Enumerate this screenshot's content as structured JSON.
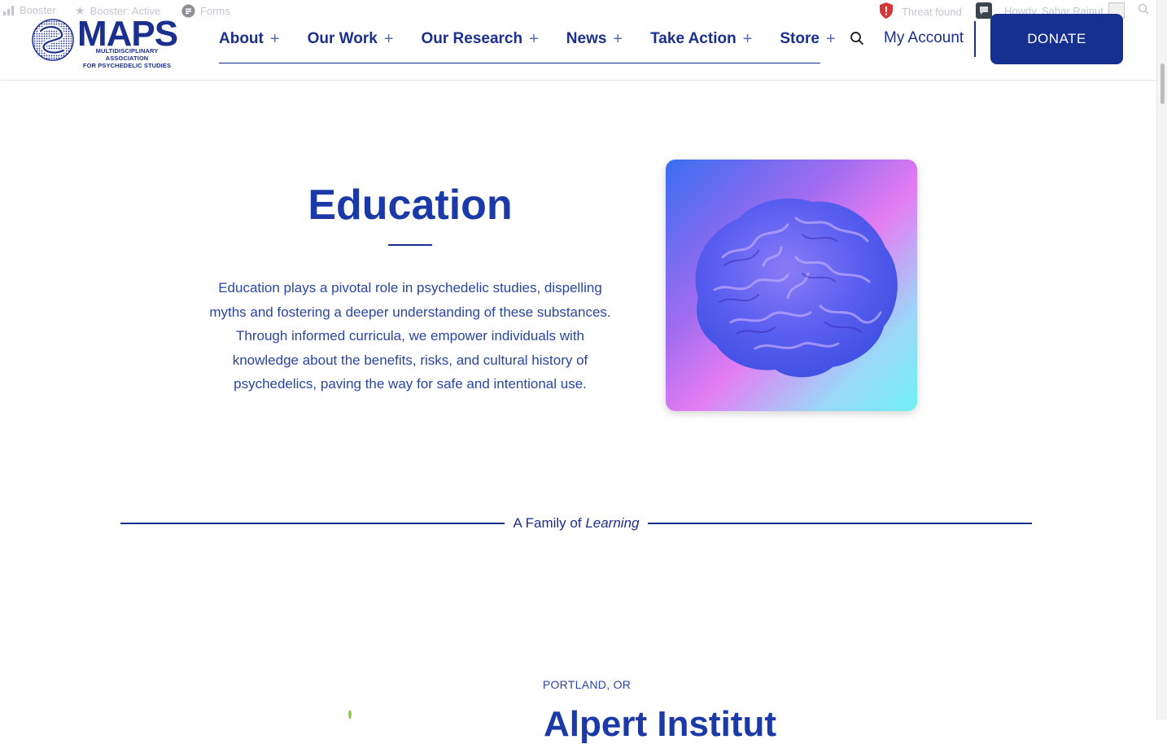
{
  "admin_bar": {
    "booster": "Booster",
    "booster_status": "Booster: Active",
    "forms": "Forms",
    "threat": "Threat found",
    "howdy": "Howdy, Sahar Rajput"
  },
  "header": {
    "logo_text": "MAPS",
    "logo_subtitle_line1": "MULTIDISCIPLINARY ASSOCIATION",
    "logo_subtitle_line2": "FOR PSYCHEDELIC STUDIES",
    "nav": [
      {
        "label": "About",
        "expand": "+"
      },
      {
        "label": "Our Work",
        "expand": "+"
      },
      {
        "label": "Our Research",
        "expand": "+"
      },
      {
        "label": "News",
        "expand": "+"
      },
      {
        "label": "Take Action",
        "expand": "+"
      },
      {
        "label": "Store",
        "expand": "+"
      }
    ],
    "my_account": "My Account",
    "donate": "DONATE"
  },
  "hero": {
    "title": "Education",
    "body": "Education plays a pivotal role in psychedelic studies, dispelling myths and fostering a deeper understanding of these substances. Through informed curricula, we empower individuals with knowledge about the benefits, risks, and cultural history of psychedelics, paving the way for safe and intentional use."
  },
  "section": {
    "family_prefix": "A Family of ",
    "family_emphasis": "Learning",
    "location": "PORTLAND, OR",
    "next_title": "Alpert Institut"
  },
  "colors": {
    "brand_blue": "#1b2f8f",
    "donate_bg": "#16308f",
    "heading_blue": "#1b3aa8"
  }
}
